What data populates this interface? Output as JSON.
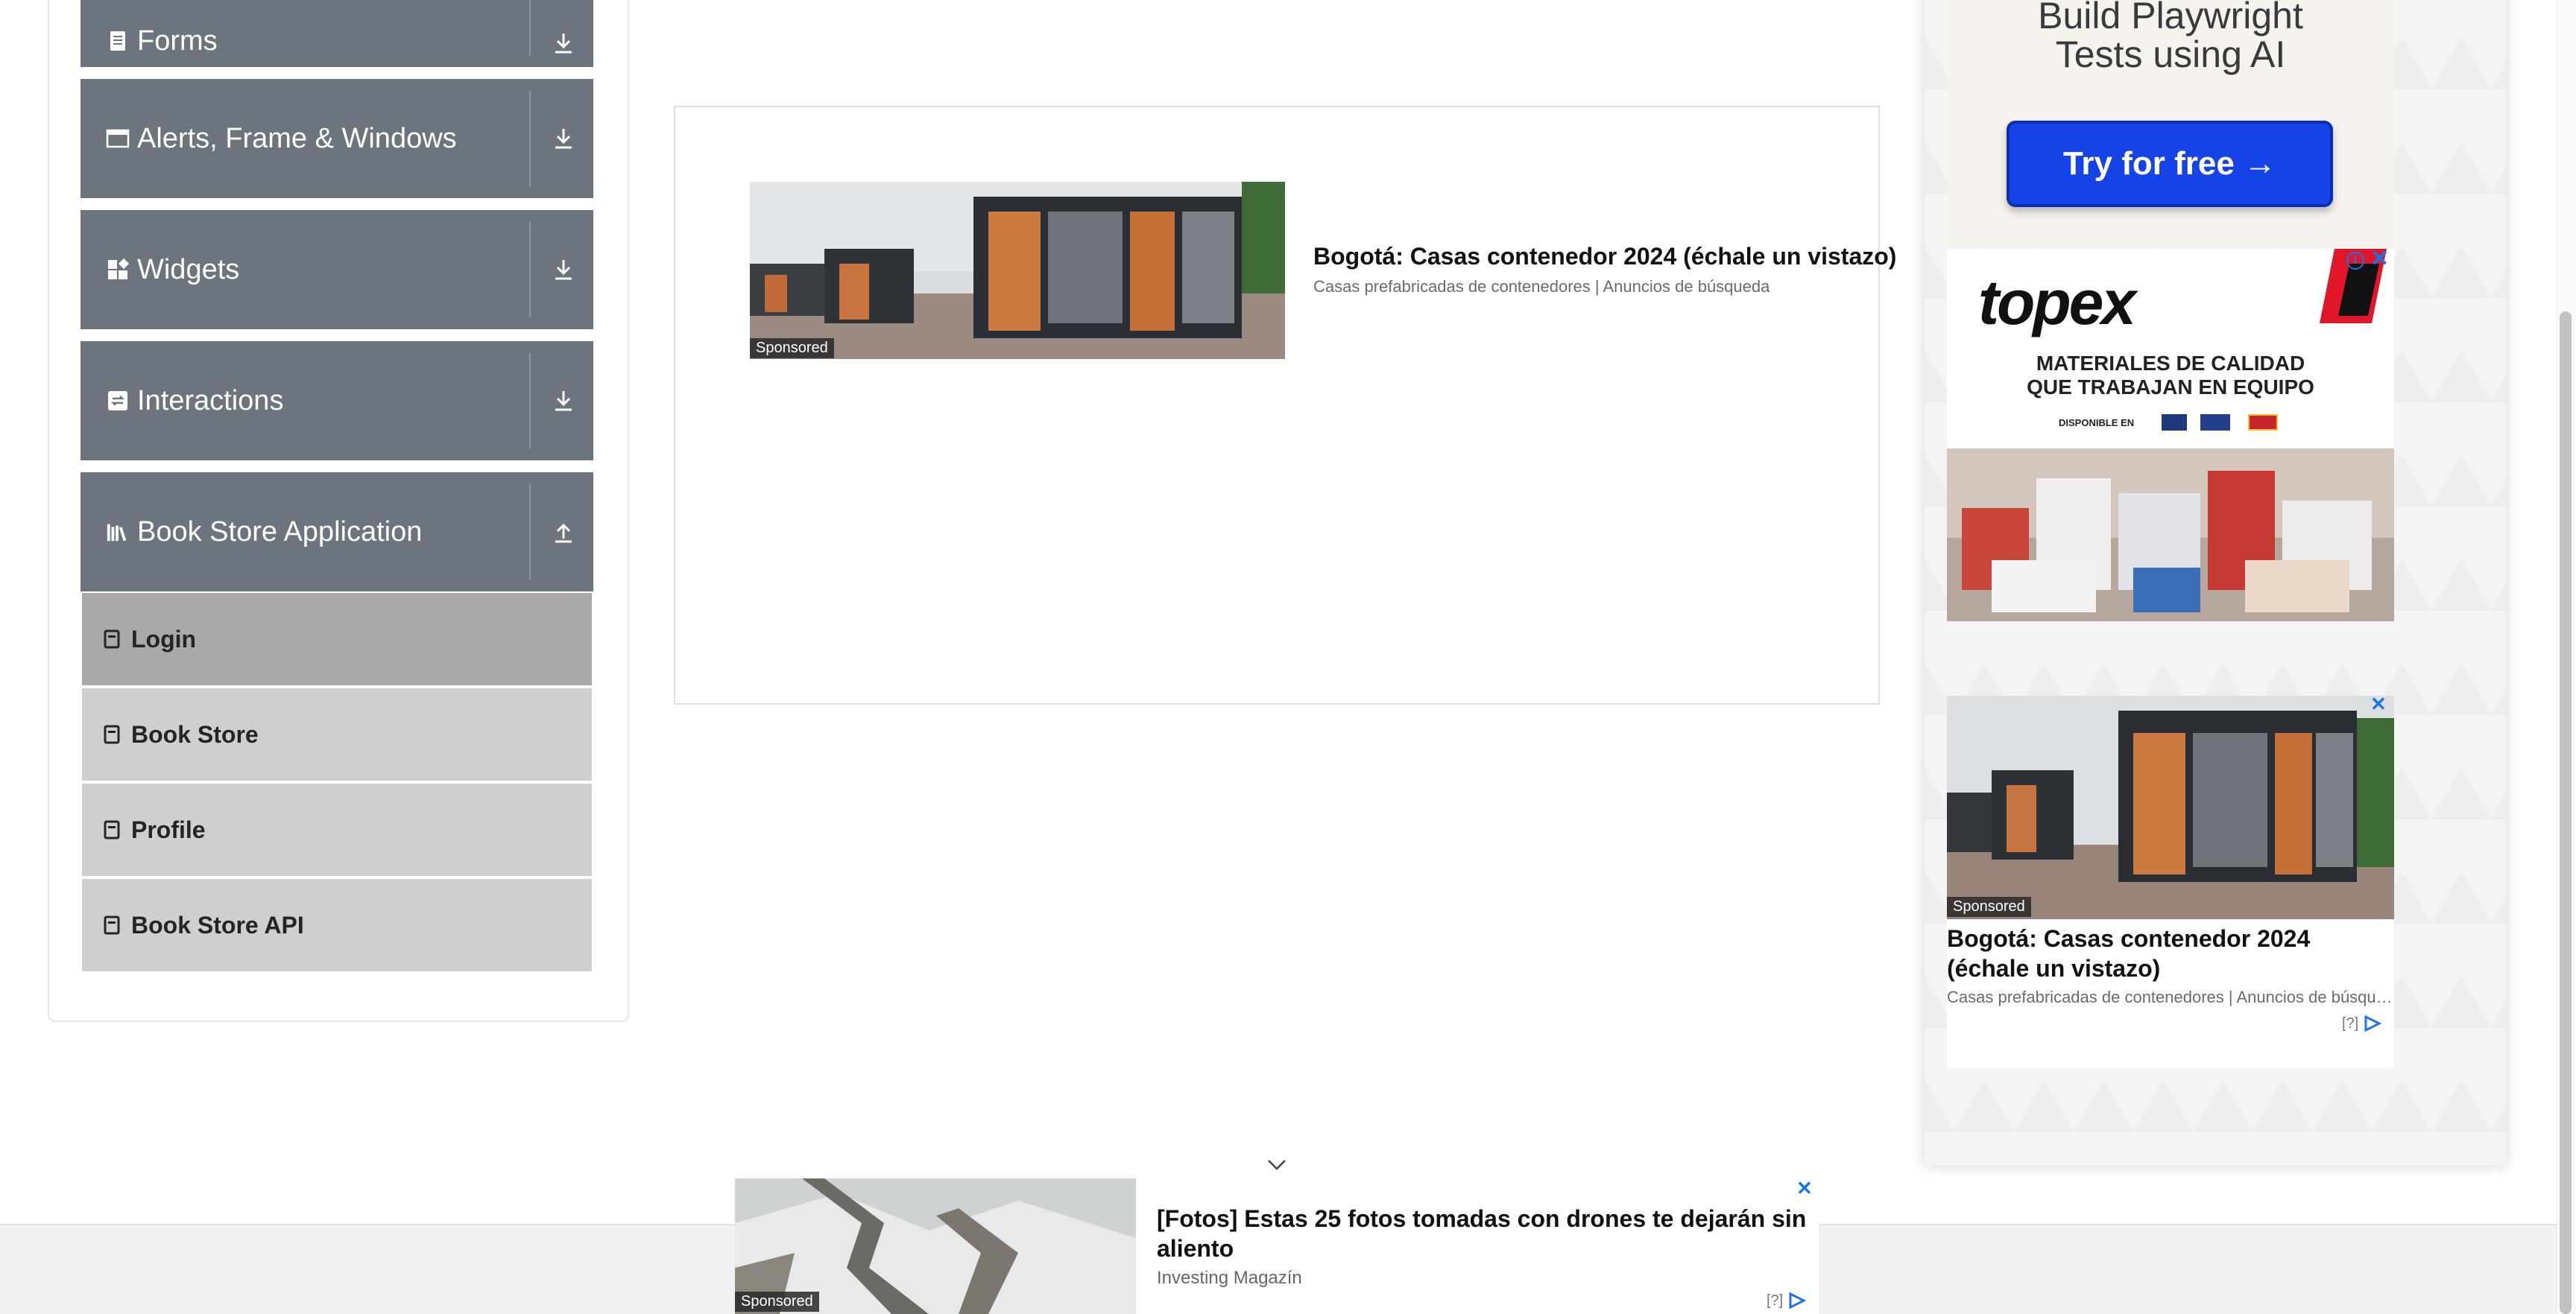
{
  "sidebar": {
    "groups": [
      {
        "label": "Forms",
        "icon": "form-icon",
        "arrow": "download-arrow-icon"
      },
      {
        "label": "Alerts, Frame & Windows",
        "icon": "window-icon",
        "arrow": "download-arrow-icon"
      },
      {
        "label": "Widgets",
        "icon": "widgets-icon",
        "arrow": "download-arrow-icon"
      },
      {
        "label": "Interactions",
        "icon": "interactions-icon",
        "arrow": "download-arrow-icon"
      },
      {
        "label": "Book Store Application",
        "icon": "books-icon",
        "arrow": "upload-arrow-icon"
      }
    ],
    "book_store_items": [
      {
        "label": "Login",
        "active": true
      },
      {
        "label": "Book Store",
        "active": false
      },
      {
        "label": "Profile",
        "active": false
      },
      {
        "label": "Book Store API",
        "active": false
      }
    ]
  },
  "center_ad": {
    "title": "Bogotá: Casas contenedor 2024 (échale un vistazo)",
    "description": "Casas prefabricadas de contenedores | Anuncios de búsqueda",
    "sponsored": "Sponsored"
  },
  "right_ads": {
    "playwright": {
      "title_line1": "Build Playwright",
      "title_line2": "Tests using AI",
      "button": "Try for free →"
    },
    "topex": {
      "logo": "topex",
      "tagline1": "MATERIALES DE CALIDAD",
      "tagline2": "QUE TRABAJAN EN EQUIPO",
      "available": "DISPONIBLE EN",
      "info": "i",
      "close": "✕"
    },
    "container_ad": {
      "title": "Bogotá: Casas contenedor 2024 (échale un vistazo)",
      "description": "Casas prefabricadas de contenedores | Anuncios de búsqueda",
      "sponsored": "Sponsored",
      "help": "[?]",
      "close": "✕"
    }
  },
  "bottom_ad": {
    "title": "[Fotos] Estas 25 fotos tomadas con drones te dejarán sin aliento",
    "source": "Investing Magazín",
    "sponsored": "Sponsored",
    "help": "[?]",
    "close": "✕"
  },
  "colors": {
    "menu_header": "#6c757d",
    "menu_item": "#cfcfcf",
    "menu_item_active": "#a9a9a9",
    "cta_blue": "#1543e6",
    "adchoice_blue": "#1a73e8"
  }
}
